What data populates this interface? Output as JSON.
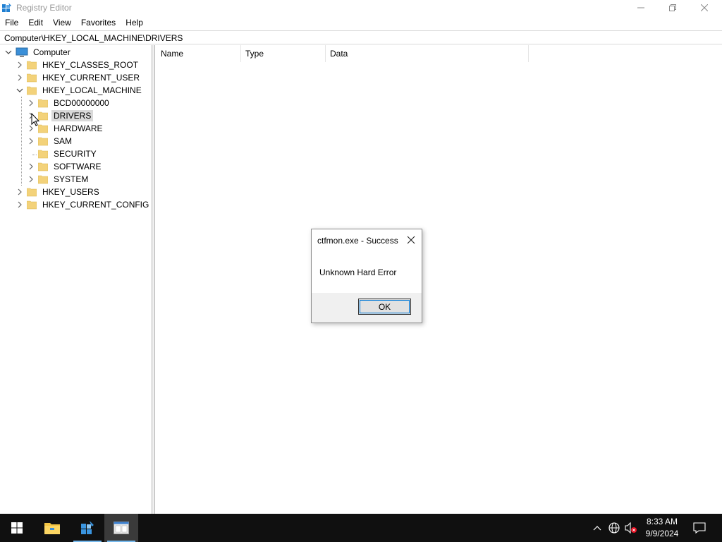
{
  "window": {
    "title": "Registry Editor",
    "icon": "regedit-icon",
    "controls": [
      "minimize-icon",
      "restore-icon",
      "close-icon"
    ]
  },
  "menu": [
    "File",
    "Edit",
    "View",
    "Favorites",
    "Help"
  ],
  "address": "Computer\\HKEY_LOCAL_MACHINE\\DRIVERS",
  "tree": {
    "root": "Computer",
    "hives": [
      {
        "label": "HKEY_CLASSES_ROOT",
        "expanded": false
      },
      {
        "label": "HKEY_CURRENT_USER",
        "expanded": false
      },
      {
        "label": "HKEY_LOCAL_MACHINE",
        "expanded": true
      },
      {
        "label": "HKEY_USERS",
        "expanded": false
      },
      {
        "label": "HKEY_CURRENT_CONFIG",
        "expanded": false
      }
    ],
    "hklm_children": [
      {
        "label": "BCD00000000",
        "has_children": true
      },
      {
        "label": "DRIVERS",
        "has_children": true,
        "selected": true
      },
      {
        "label": "HARDWARE",
        "has_children": true
      },
      {
        "label": "SAM",
        "has_children": true
      },
      {
        "label": "SECURITY",
        "has_children": false
      },
      {
        "label": "SOFTWARE",
        "has_children": true
      },
      {
        "label": "SYSTEM",
        "has_children": true
      }
    ]
  },
  "list": {
    "columns": [
      "Name",
      "Type",
      "Data"
    ]
  },
  "dialog": {
    "title": "ctfmon.exe - Success",
    "message": "Unknown Hard Error",
    "ok_label": "OK"
  },
  "taskbar": {
    "apps": [
      "start-icon",
      "file-explorer-icon",
      "regedit-icon",
      "console-window-icon"
    ],
    "tray": [
      "chevron-up-icon",
      "network-icon",
      "volume-muted-icon"
    ],
    "time": "8:33 AM",
    "date": "9/9/2024",
    "notification_icon": "action-center-icon"
  },
  "colors": {
    "taskbar": "#101010",
    "folder": "#f3d27a",
    "selection": "#d9d9d9",
    "focus": "#0078d7"
  }
}
